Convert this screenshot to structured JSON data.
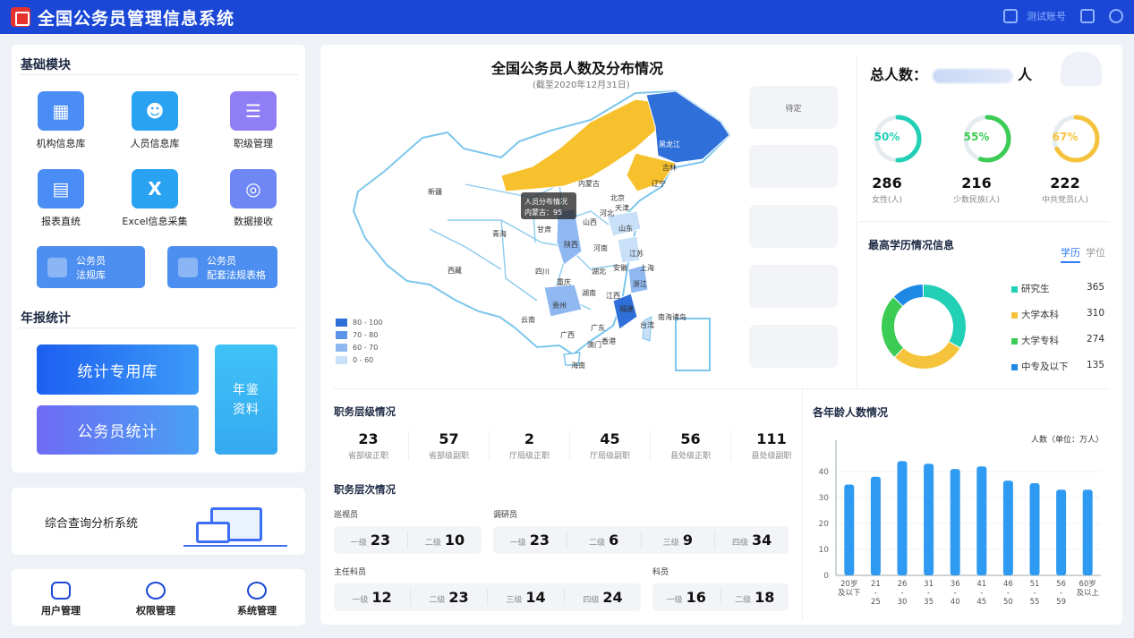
{
  "header": {
    "title": "全国公务员管理信息系统",
    "account": "测试账号",
    "logo_icon": "cube-logo-icon"
  },
  "sidebar": {
    "basic_title": "基础模块",
    "modules": [
      {
        "label": "机构信息库",
        "icon": "building-icon",
        "color": "#4a8df5"
      },
      {
        "label": "人员信息库",
        "icon": "person-card-icon",
        "color": "#2aa2f2"
      },
      {
        "label": "职级管理",
        "icon": "rank-icon",
        "color": "#8f7ef5"
      },
      {
        "label": "报表直统",
        "icon": "report-icon",
        "color": "#4a8df5"
      },
      {
        "label": "Excel信息采集",
        "icon": "excel-icon",
        "color": "#2aa2f2"
      },
      {
        "label": "数据接收",
        "icon": "database-icon",
        "color": "#6f87f5"
      }
    ],
    "small_buttons": [
      {
        "line1": "公务员",
        "line2": "法规库"
      },
      {
        "line1": "公务员",
        "line2": "配套法规表格"
      }
    ],
    "annual_title": "年报统计",
    "stats_lib": "统计专用库",
    "civil_stats": "公务员统计",
    "yearbook": "年鉴资料",
    "query_system": "综合查询分析系统",
    "bottom_nav": [
      {
        "label": "用户管理",
        "icon": "users-icon"
      },
      {
        "label": "权限管理",
        "icon": "shield-icon"
      },
      {
        "label": "系统管理",
        "icon": "system-icon"
      }
    ]
  },
  "map": {
    "title": "全国公务员人数及分布情况",
    "subtitle": "(截至2020年12月31日)",
    "tooltip_title": "人员分布情况",
    "tooltip_value": "内蒙古：95",
    "legend": [
      {
        "label": "80 - 100",
        "color": "#2f6fd9"
      },
      {
        "label": "70 - 80",
        "color": "#5b94e6"
      },
      {
        "label": "60 - 70",
        "color": "#8fb8f0"
      },
      {
        "label": "0 - 60",
        "color": "#c8e0f8"
      }
    ],
    "regions": [
      "新疆",
      "西藏",
      "青海",
      "甘肃",
      "内蒙古",
      "黑龙江",
      "吉林",
      "辽宁",
      "北京",
      "天津",
      "河北",
      "山西",
      "山东",
      "陕西",
      "河南",
      "江苏",
      "安徽",
      "上海",
      "湖北",
      "四川",
      "重庆",
      "浙江",
      "湖南",
      "江西",
      "贵州",
      "福建",
      "云南",
      "广西",
      "广东",
      "台湾",
      "澳门",
      "香港",
      "海南",
      "南海诸岛"
    ],
    "pending_label": "待定"
  },
  "summary": {
    "total_label": "总人数：",
    "total_unit": "人",
    "rings": [
      {
        "pct": "50%",
        "value": "286",
        "label": "女性(人)",
        "color": "#22d0b6",
        "fraction": 0.5
      },
      {
        "pct": "55%",
        "value": "216",
        "label": "少数民族(人)",
        "color": "#3ccb55",
        "fraction": 0.55
      },
      {
        "pct": "67%",
        "value": "222",
        "label": "中共党员(人)",
        "color": "#f5c33b",
        "fraction": 0.67
      }
    ]
  },
  "education": {
    "title": "最高学历情况信息",
    "tab_active": "学历",
    "tab_other": "学位",
    "items": [
      {
        "label": "研究生",
        "value": "365",
        "color": "#22d0b6"
      },
      {
        "label": "大学本科",
        "value": "310",
        "color": "#f5c33b"
      },
      {
        "label": "大学专科",
        "value": "274",
        "color": "#3ccb55"
      },
      {
        "label": "中专及以下",
        "value": "135",
        "color": "#1e88e5"
      }
    ]
  },
  "levels": {
    "title": "职务层级情况",
    "items": [
      {
        "value": "23",
        "label": "省部级正职"
      },
      {
        "value": "57",
        "label": "省部级副职"
      },
      {
        "value": "2",
        "label": "厅局级正职"
      },
      {
        "value": "45",
        "label": "厅局级副职"
      },
      {
        "value": "56",
        "label": "县处级正职"
      },
      {
        "value": "111",
        "label": "县处级副职"
      }
    ]
  },
  "ranks": {
    "title": "职务层次情况",
    "groups": {
      "inspector": {
        "label": "巡视员",
        "items": [
          {
            "k": "一级",
            "v": "23"
          },
          {
            "k": "二级",
            "v": "10"
          }
        ]
      },
      "researcher": {
        "label": "调研员",
        "items": [
          {
            "k": "一级",
            "v": "23"
          },
          {
            "k": "二级",
            "v": "6"
          },
          {
            "k": "三级",
            "v": "9"
          },
          {
            "k": "四级",
            "v": "34"
          }
        ]
      },
      "chief": {
        "label": "主任科员",
        "items": [
          {
            "k": "一级",
            "v": "12"
          },
          {
            "k": "二级",
            "v": "23"
          },
          {
            "k": "三级",
            "v": "14"
          },
          {
            "k": "四级",
            "v": "24"
          }
        ]
      },
      "clerk": {
        "label": "科员",
        "items": [
          {
            "k": "一级",
            "v": "16"
          },
          {
            "k": "二级",
            "v": "18"
          }
        ]
      }
    }
  },
  "age_chart": {
    "title": "各年龄人数情况",
    "unit": "人数（单位：万人）"
  },
  "chart_data": {
    "type": "bar",
    "title": "各年龄人数情况",
    "ylabel": "人数（单位：万人）",
    "categories": [
      "20岁及以下",
      "21-25",
      "26-30",
      "31-35",
      "36-40",
      "41-45",
      "46-50",
      "51-55",
      "56-59",
      "60岁及以上"
    ],
    "tick_lines": [
      [
        "20岁",
        "及以下"
      ],
      [
        "21",
        "-",
        "25"
      ],
      [
        "26",
        "-",
        "30"
      ],
      [
        "31",
        "-",
        "35"
      ],
      [
        "36",
        "-",
        "40"
      ],
      [
        "41",
        "-",
        "45"
      ],
      [
        "46",
        "-",
        "50"
      ],
      [
        "51",
        "-",
        "55"
      ],
      [
        "56",
        "-",
        "59"
      ],
      [
        "60岁",
        "及以上"
      ]
    ],
    "values": [
      35,
      38,
      44,
      43,
      41,
      42,
      36.5,
      35.5,
      33,
      33
    ],
    "ylim": [
      0,
      50
    ],
    "yticks": [
      0,
      10,
      20,
      30,
      40
    ],
    "color": "#2f9af2",
    "grid": true
  }
}
